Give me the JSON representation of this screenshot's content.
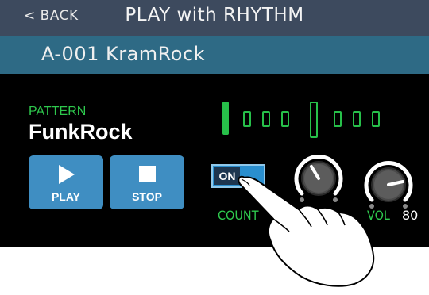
{
  "header": {
    "back_label": "< BACK",
    "title": "PLAY with RHYTHM"
  },
  "project": {
    "name": "A-001 KramRock"
  },
  "pattern": {
    "label": "PATTERN",
    "name": "FunkRock"
  },
  "transport": {
    "play_label": "PLAY",
    "stop_label": "STOP"
  },
  "beat_indicator": {
    "beats": 8,
    "current_beat": 1,
    "active_color": "#27c04a"
  },
  "count_in": {
    "toggle_label": "ON",
    "label": "COUNT",
    "state": "on"
  },
  "volume": {
    "label": "VOL",
    "value": "80"
  },
  "colors": {
    "header_bg": "#3d4a5e",
    "namebar_bg": "#2e6a85",
    "accent_green": "#2ec84d",
    "button_blue": "#3f8ec2"
  }
}
